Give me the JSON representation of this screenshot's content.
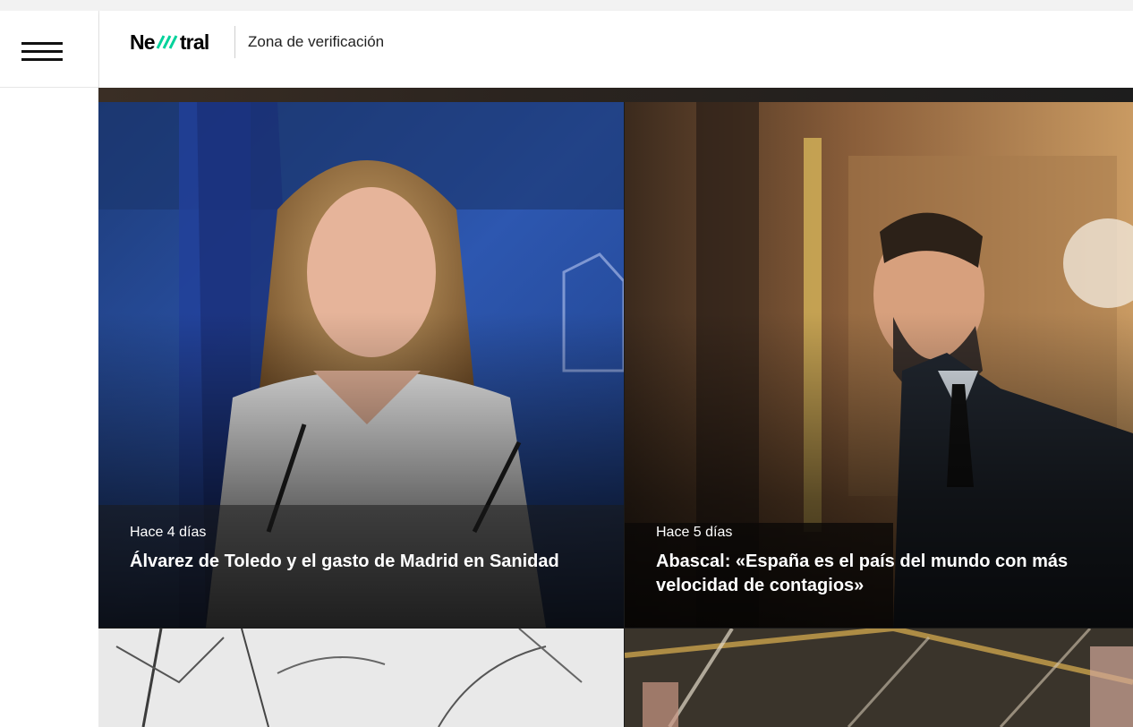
{
  "header": {
    "logo_text": "Newtral",
    "section_title": "Zona de verificación"
  },
  "icons": {
    "menu": "hamburger-menu-icon"
  },
  "colors": {
    "header_bg": "#ffffff",
    "text_dark": "#111111",
    "overlay_text": "#ffffff"
  },
  "cards": [
    {
      "time": "Hace 4 días",
      "headline": "Álvarez de Toledo y el gasto de Madrid en Sanidad"
    },
    {
      "time": "Hace 5 días",
      "headline": "Abascal: «España es el país del mundo con más velocidad de contagios»"
    },
    {
      "time": "",
      "headline": ""
    },
    {
      "time": "",
      "headline": ""
    }
  ]
}
